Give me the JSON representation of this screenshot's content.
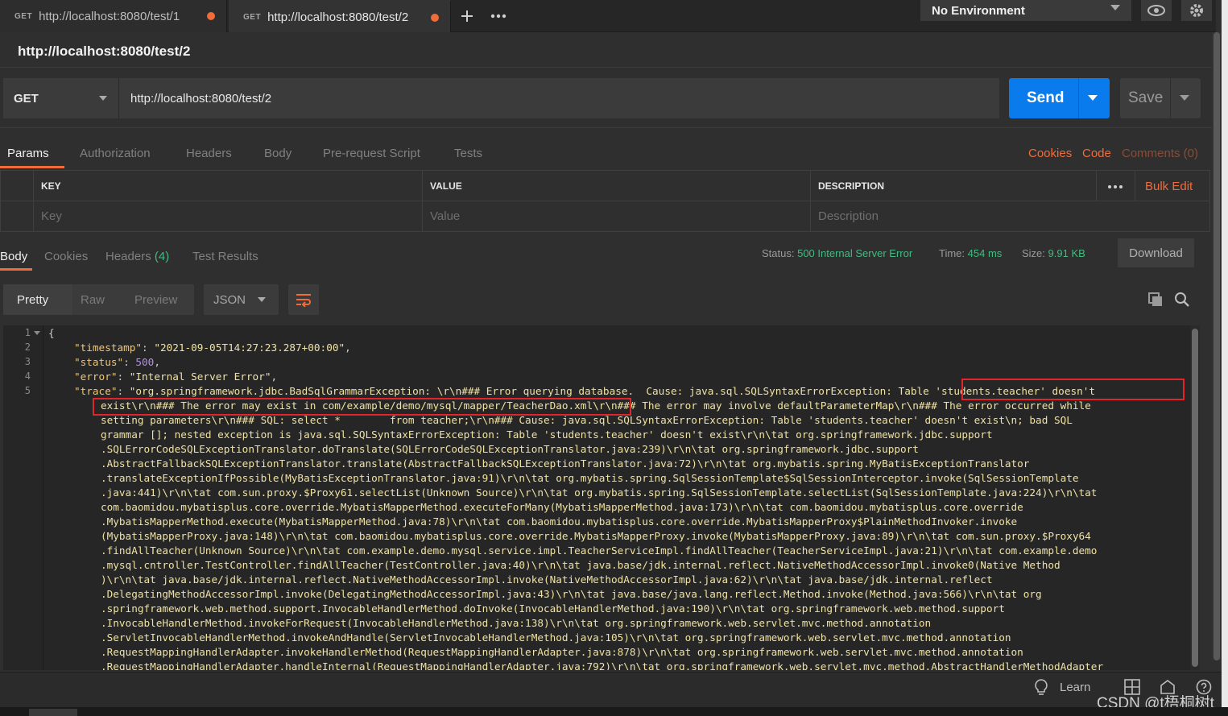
{
  "tabs": [
    {
      "method": "GET",
      "url": "http://localhost:8080/test/1",
      "unsaved": true
    },
    {
      "method": "GET",
      "url": "http://localhost:8080/test/2",
      "unsaved": true
    }
  ],
  "environment": "No Environment",
  "request": {
    "title": "http://localhost:8080/test/2",
    "method": "GET",
    "url": "http://localhost:8080/test/2",
    "send_label": "Send",
    "save_label": "Save"
  },
  "request_tabs": [
    "Params",
    "Authorization",
    "Headers",
    "Body",
    "Pre-request Script",
    "Tests"
  ],
  "request_links": {
    "cookies": "Cookies",
    "code": "Code",
    "comments": "Comments (0)"
  },
  "params": {
    "headers": {
      "key": "KEY",
      "value": "VALUE",
      "description": "DESCRIPTION"
    },
    "placeholders": {
      "key": "Key",
      "value": "Value",
      "description": "Description"
    },
    "bulk_edit": "Bulk Edit"
  },
  "response_tabs": {
    "body": "Body",
    "cookies": "Cookies",
    "headers": "Headers",
    "headers_count": "(4)",
    "tests": "Test Results"
  },
  "status": {
    "status_label": "Status:",
    "status_value": "500 Internal Server Error",
    "time_label": "Time:",
    "time_value": "454 ms",
    "size_label": "Size:",
    "size_value": "9.91 KB"
  },
  "download_label": "Download",
  "view_modes": {
    "pretty": "Pretty",
    "raw": "Raw",
    "preview": "Preview"
  },
  "format": "JSON",
  "line_numbers": [
    "1",
    "2",
    "3",
    "4",
    "5"
  ],
  "response_body": {
    "l1": "{",
    "l2_key": "\"timestamp\"",
    "l2_val": "\"2021-09-05T14:27:23.287+00:00\"",
    "l3_key": "\"status\"",
    "l3_val": "500",
    "l4_key": "\"error\"",
    "l4_val": "\"Internal Server Error\"",
    "l5_key": "\"trace\"",
    "trace_lines": [
      "\"org.springframework.jdbc.BadSqlGrammarException: \\r\\n### Error querying database.  Cause: java.sql.SQLSyntaxErrorException: Table 'students.teacher' doesn't",
      "exist\\r\\n### The error may exist in com/example/demo/mysql/mapper/TeacherDao.xml\\r\\n### The error may involve defaultParameterMap\\r\\n### The error occurred while",
      "setting parameters\\r\\n### SQL: select *        from teacher;\\r\\n### Cause: java.sql.SQLSyntaxErrorException: Table 'students.teacher' doesn't exist\\n; bad SQL",
      "grammar []; nested exception is java.sql.SQLSyntaxErrorException: Table 'students.teacher' doesn't exist\\r\\n\\tat org.springframework.jdbc.support",
      ".SQLErrorCodeSQLExceptionTranslator.doTranslate(SQLErrorCodeSQLExceptionTranslator.java:239)\\r\\n\\tat org.springframework.jdbc.support",
      ".AbstractFallbackSQLExceptionTranslator.translate(AbstractFallbackSQLExceptionTranslator.java:72)\\r\\n\\tat org.mybatis.spring.MyBatisExceptionTranslator",
      ".translateExceptionIfPossible(MyBatisExceptionTranslator.java:91)\\r\\n\\tat org.mybatis.spring.SqlSessionTemplate$SqlSessionInterceptor.invoke(SqlSessionTemplate",
      ".java:441)\\r\\n\\tat com.sun.proxy.$Proxy61.selectList(Unknown Source)\\r\\n\\tat org.mybatis.spring.SqlSessionTemplate.selectList(SqlSessionTemplate.java:224)\\r\\n\\tat",
      "com.baomidou.mybatisplus.core.override.MybatisMapperMethod.executeForMany(MybatisMapperMethod.java:173)\\r\\n\\tat com.baomidou.mybatisplus.core.override",
      ".MybatisMapperMethod.execute(MybatisMapperMethod.java:78)\\r\\n\\tat com.baomidou.mybatisplus.core.override.MybatisMapperProxy$PlainMethodInvoker.invoke",
      "(MybatisMapperProxy.java:148)\\r\\n\\tat com.baomidou.mybatisplus.core.override.MybatisMapperProxy.invoke(MybatisMapperProxy.java:89)\\r\\n\\tat com.sun.proxy.$Proxy64",
      ".findAllTeacher(Unknown Source)\\r\\n\\tat com.example.demo.mysql.service.impl.TeacherServiceImpl.findAllTeacher(TeacherServiceImpl.java:21)\\r\\n\\tat com.example.demo",
      ".mysql.cntroller.TestController.findAllTeacher(TestController.java:40)\\r\\n\\tat java.base/jdk.internal.reflect.NativeMethodAccessorImpl.invoke0(Native Method",
      ")\\r\\n\\tat java.base/jdk.internal.reflect.NativeMethodAccessorImpl.invoke(NativeMethodAccessorImpl.java:62)\\r\\n\\tat java.base/jdk.internal.reflect",
      ".DelegatingMethodAccessorImpl.invoke(DelegatingMethodAccessorImpl.java:43)\\r\\n\\tat java.base/java.lang.reflect.Method.invoke(Method.java:566)\\r\\n\\tat org",
      ".springframework.web.method.support.InvocableHandlerMethod.doInvoke(InvocableHandlerMethod.java:190)\\r\\n\\tat org.springframework.web.method.support",
      ".InvocableHandlerMethod.invokeForRequest(InvocableHandlerMethod.java:138)\\r\\n\\tat org.springframework.web.servlet.mvc.method.annotation",
      ".ServletInvocableHandlerMethod.invokeAndHandle(ServletInvocableHandlerMethod.java:105)\\r\\n\\tat org.springframework.web.servlet.mvc.method.annotation",
      ".RequestMappingHandlerAdapter.invokeHandlerMethod(RequestMappingHandlerAdapter.java:878)\\r\\n\\tat org.springframework.web.servlet.mvc.method.annotation",
      ".RequestMappingHandlerAdapter.handleInternal(RequestMappingHandlerAdapter.java:792)\\r\\n\\tat org.springframework.web.servlet.mvc.method.AbstractHandlerMethodAdapter"
    ]
  },
  "footer": {
    "learn": "Learn"
  },
  "watermark": "CSDN @t梧桐树t",
  "colors": {
    "accent": "#f26b3a",
    "send": "#097bed",
    "status_ok_green": "#47b881",
    "highlight_box": "#e0262b"
  },
  "icons": [
    "plus-icon",
    "more-icon",
    "eye-icon",
    "gear-icon",
    "copy-icon",
    "search-icon",
    "wrap-icon",
    "bulb-icon",
    "layout-icon",
    "bootcamp-icon",
    "help-icon"
  ]
}
